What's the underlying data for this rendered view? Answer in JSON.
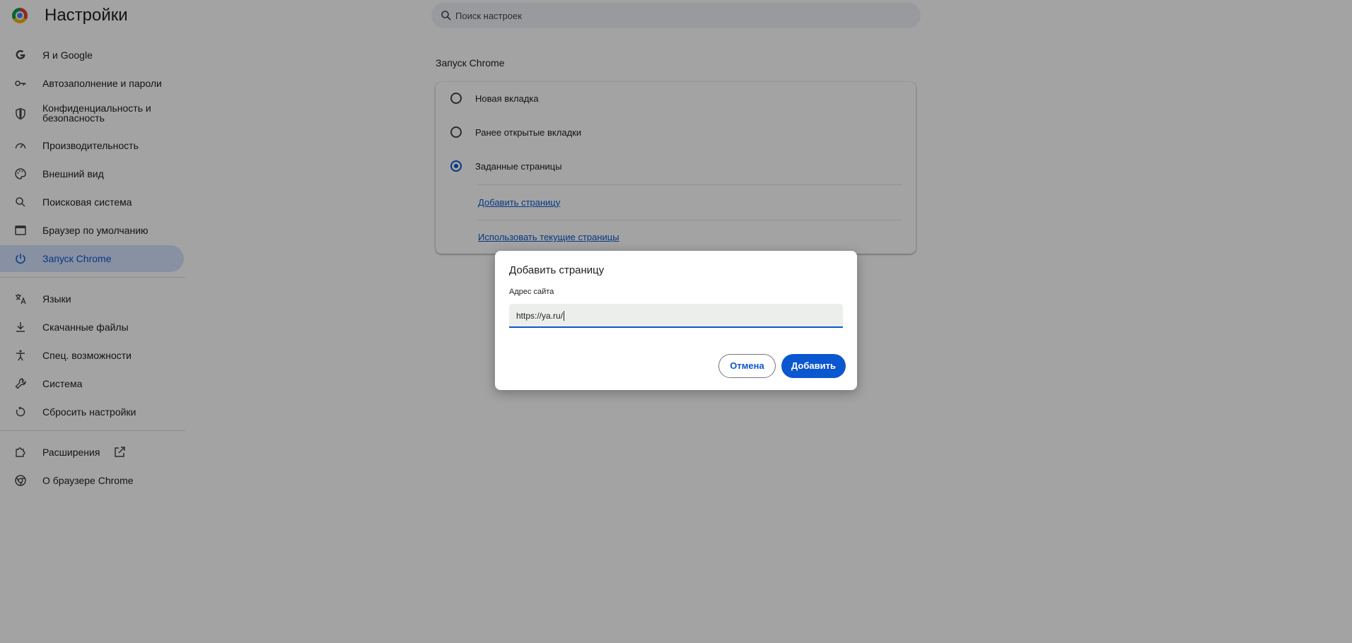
{
  "header": {
    "title": "Настройки",
    "search_placeholder": "Поиск настроек"
  },
  "sidebar": {
    "items": [
      {
        "label": "Я и Google",
        "icon": "google-g-icon"
      },
      {
        "label": "Автозаполнение и пароли",
        "icon": "key-icon"
      },
      {
        "label": "Конфиденциальность и безопасность",
        "icon": "shield-icon"
      },
      {
        "label": "Производительность",
        "icon": "speedometer-icon"
      },
      {
        "label": "Внешний вид",
        "icon": "palette-icon"
      },
      {
        "label": "Поисковая система",
        "icon": "search-icon"
      },
      {
        "label": "Браузер по умолчанию",
        "icon": "browser-window-icon"
      },
      {
        "label": "Запуск Chrome",
        "icon": "power-icon",
        "active": true
      },
      {
        "label": "Языки",
        "icon": "translate-icon"
      },
      {
        "label": "Скачанные файлы",
        "icon": "download-icon"
      },
      {
        "label": "Спец. возможности",
        "icon": "accessibility-icon"
      },
      {
        "label": "Система",
        "icon": "wrench-icon"
      },
      {
        "label": "Сбросить настройки",
        "icon": "reset-icon"
      },
      {
        "label": "Расширения",
        "icon": "puzzle-icon"
      },
      {
        "label": "О браузере Chrome",
        "icon": "chrome-icon"
      }
    ]
  },
  "main": {
    "section_title": "Запуск Chrome",
    "options": [
      {
        "label": "Новая вкладка",
        "selected": false
      },
      {
        "label": "Ранее открытые вкладки",
        "selected": false
      },
      {
        "label": "Заданные страницы",
        "selected": true
      }
    ],
    "add_page_link": "Добавить страницу",
    "use_current_link": "Использовать текущие страницы"
  },
  "dialog": {
    "title": "Добавить страницу",
    "field_label": "Адрес сайта",
    "field_value": "https://ya.ru/",
    "cancel_label": "Отмена",
    "add_label": "Добавить"
  },
  "colors": {
    "accent": "#0b57d0",
    "active_bg": "#d3e3fd",
    "scrim": "rgba(0,0,0,0.36)"
  }
}
